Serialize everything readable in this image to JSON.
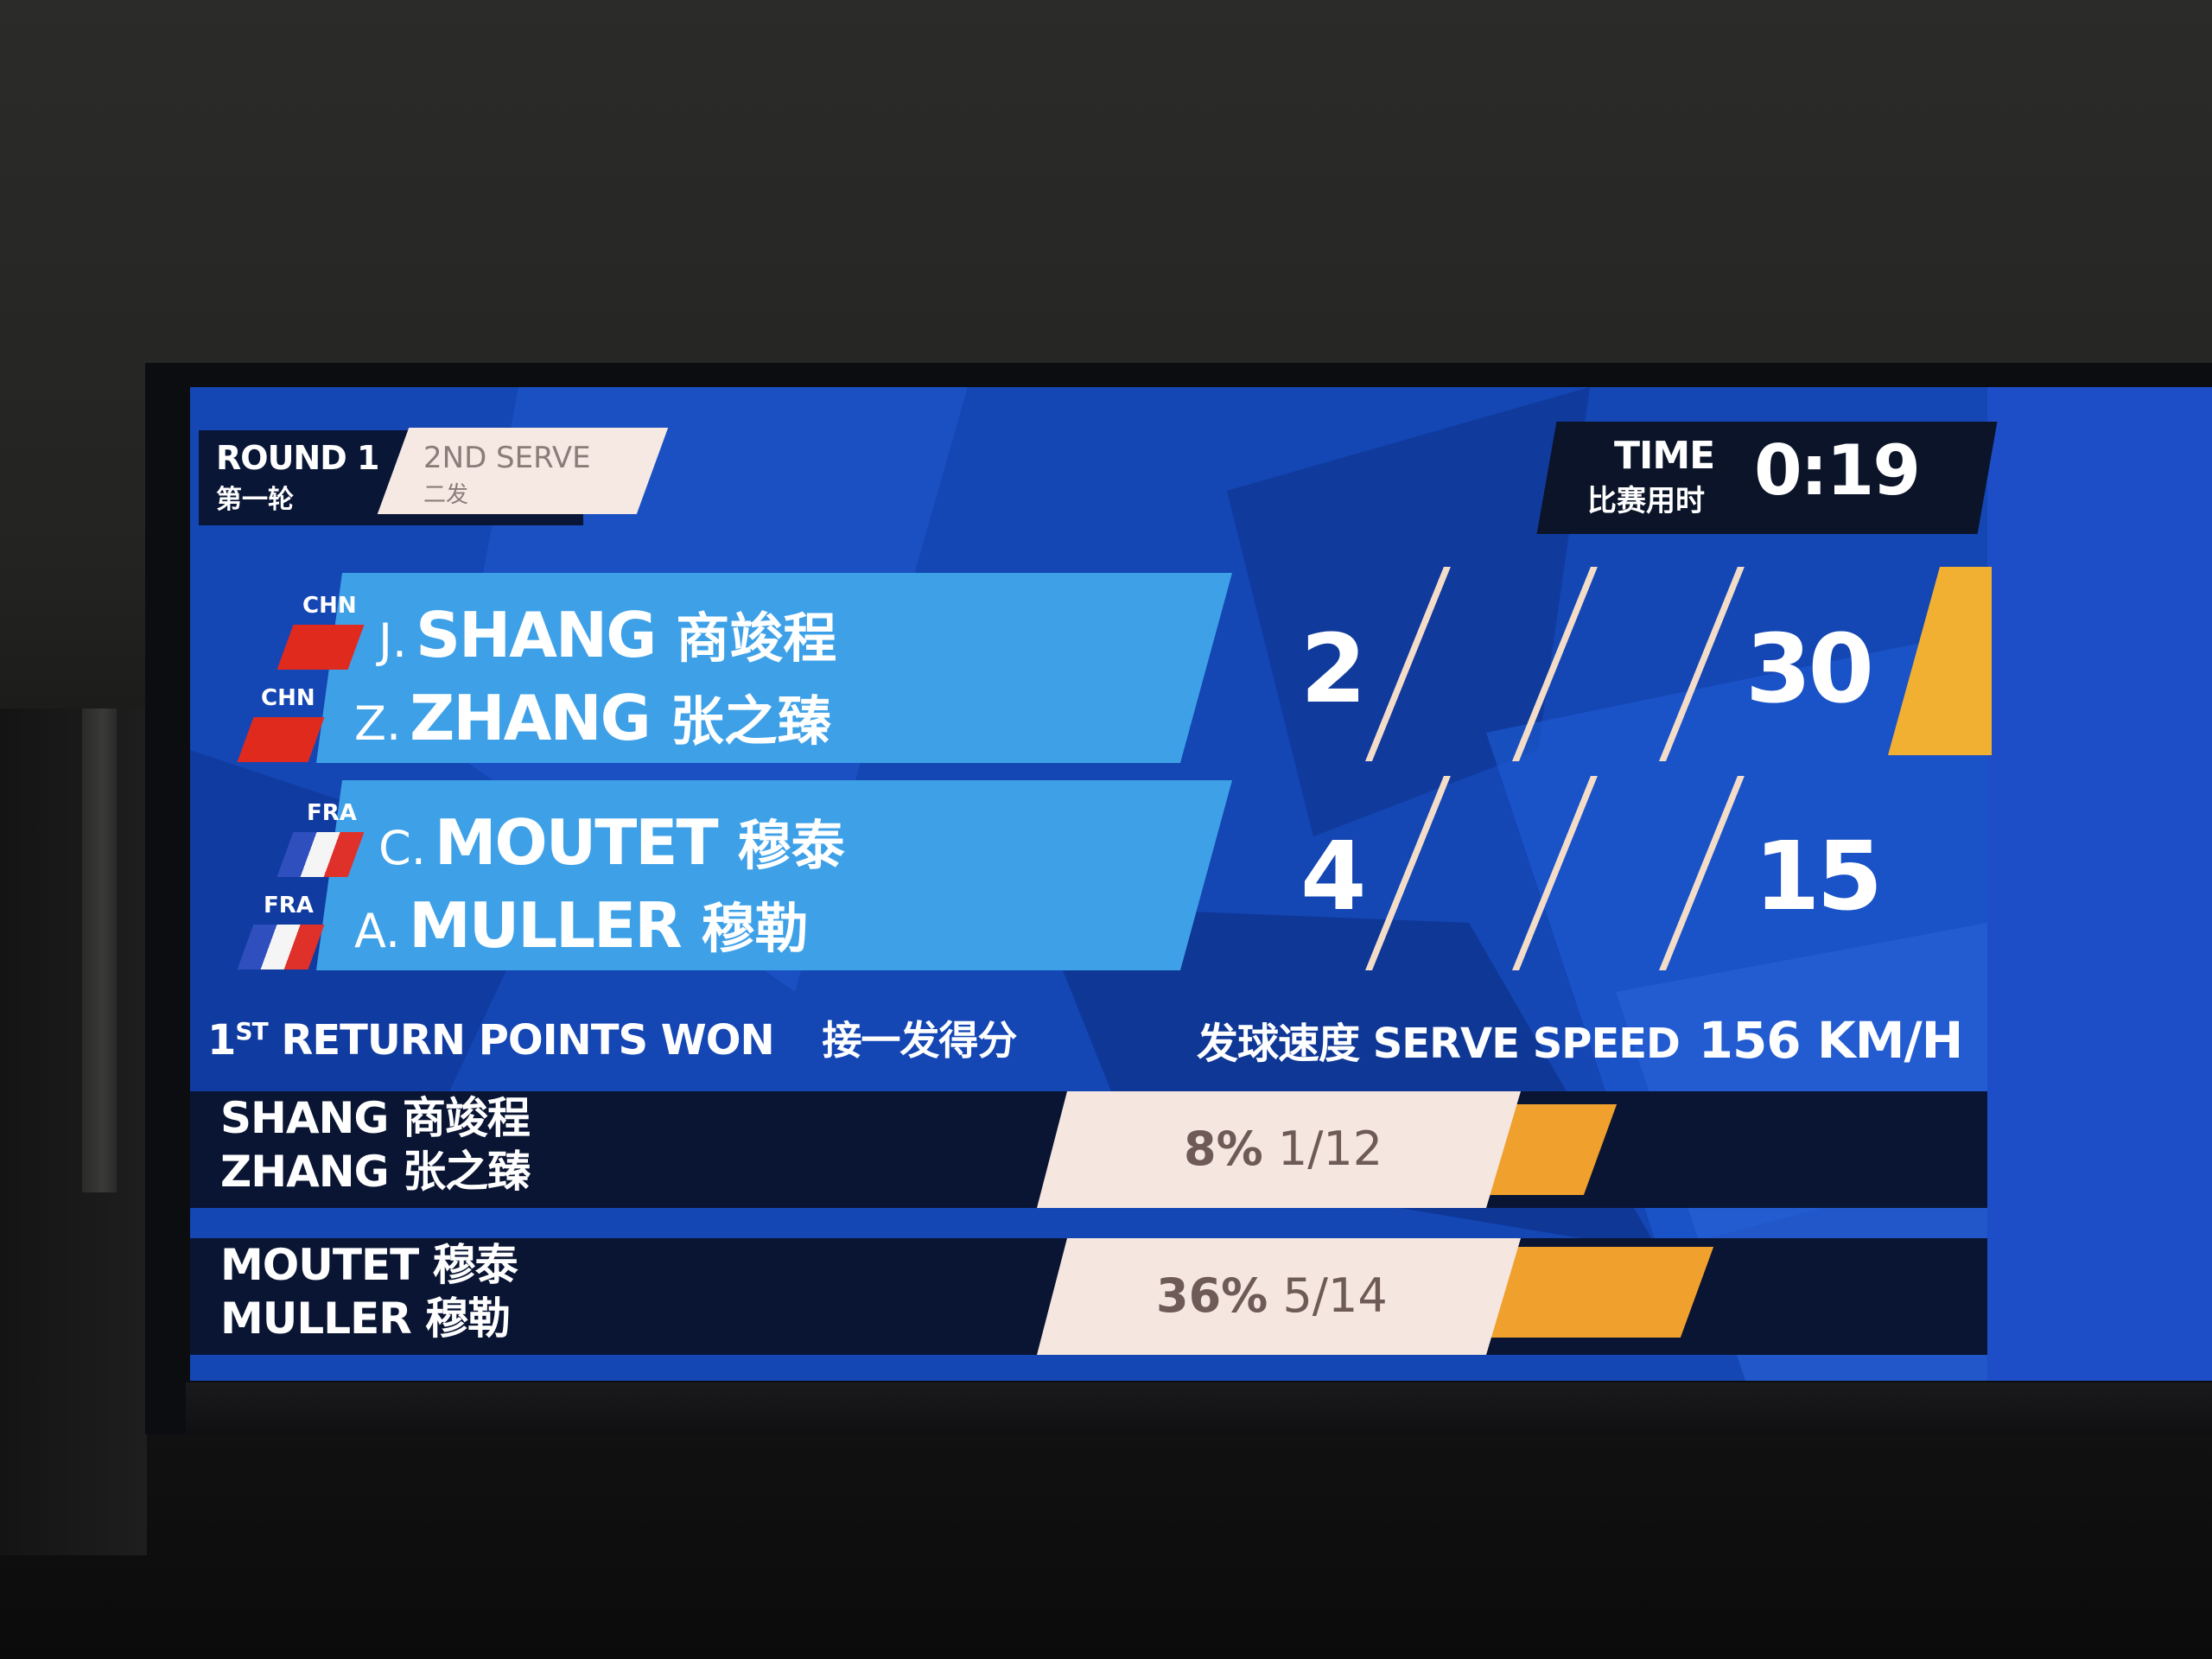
{
  "header": {
    "round_en": "ROUND 1",
    "round_cn": "第一轮",
    "serve_en": "2ND SERVE",
    "serve_cn": "二发",
    "time_en": "TIME",
    "time_cn": "比赛用时",
    "time_value": "0:19"
  },
  "teams": [
    {
      "players": [
        {
          "country": "CHN",
          "initial": "J.",
          "name": "SHANG",
          "name_cn": "商竣程"
        },
        {
          "country": "CHN",
          "initial": "Z.",
          "name": "ZHANG",
          "name_cn": "张之臻"
        }
      ],
      "games": "2",
      "points": "30",
      "serving": true
    },
    {
      "players": [
        {
          "country": "FRA",
          "initial": "C.",
          "name": "MOUTET",
          "name_cn": "穆泰"
        },
        {
          "country": "FRA",
          "initial": "A.",
          "name": "MULLER",
          "name_cn": "穆勒"
        }
      ],
      "games": "4",
      "points": "15",
      "serving": false
    }
  ],
  "stats": {
    "title_prefix": "1",
    "title_sup": "ST",
    "title_rest": "RETURN POINTS WON",
    "title_cn": "接一发得分",
    "speed_cn": "发球速度",
    "speed_en": "SERVE SPEED",
    "speed_value": "156 KM/H",
    "rows": [
      {
        "line1": "SHANG 商竣程",
        "line2": "ZHANG 张之臻",
        "pct": "8%",
        "ratio": "1/12",
        "fraction": 0.08
      },
      {
        "line1": "MOUTET 穆泰",
        "line2": "MULLER 穆勒",
        "pct": "36%",
        "ratio": "5/14",
        "fraction": 0.36
      }
    ]
  },
  "colors": {
    "screen_blue": "#123fa8",
    "team_bar": "#3ea1e8",
    "accent_orange": "#f2b032",
    "stat_box": "#f5e6df"
  }
}
